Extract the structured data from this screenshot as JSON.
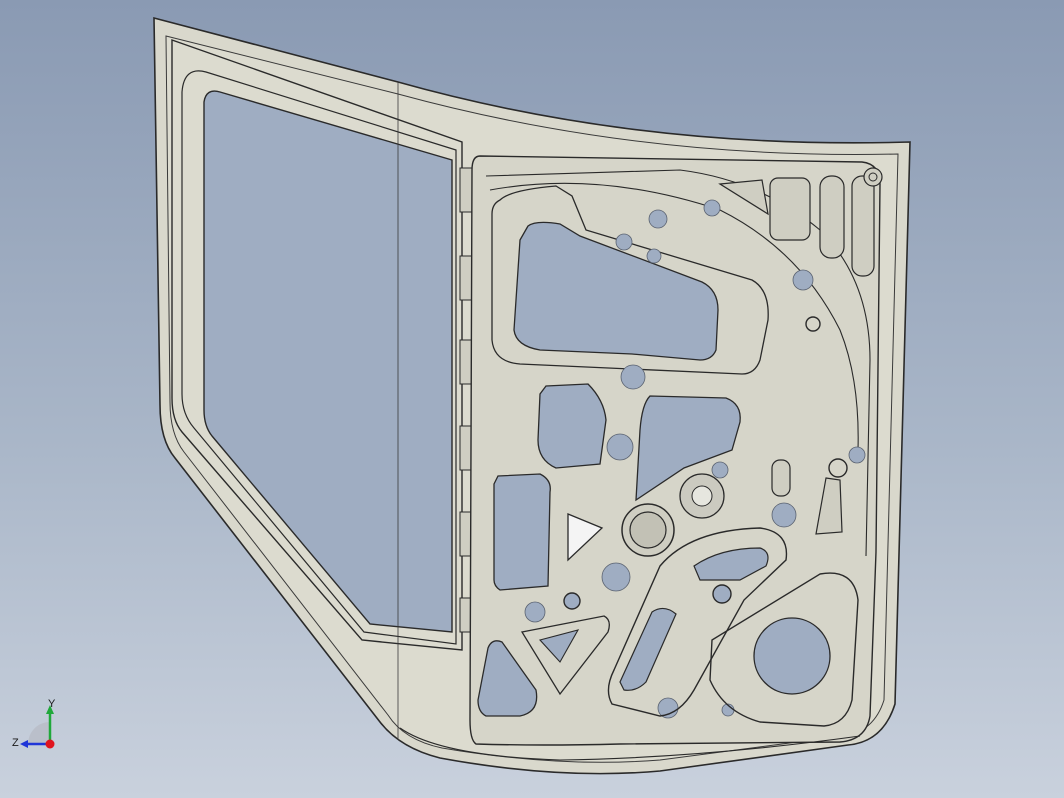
{
  "viewport": {
    "background_top": "#8a9ab3",
    "background_bottom": "#c9d1dd"
  },
  "part": {
    "type": "car door inner panel (CAD model)",
    "face_color": "#d7d6ca",
    "edge_color": "#2a2a2a",
    "hole_color": "#9aa7bc"
  },
  "triad": {
    "x_color": "#e0141e",
    "y_color": "#1fa83a",
    "z_color": "#2036d8",
    "y_label": "Y",
    "z_label": "Z"
  }
}
